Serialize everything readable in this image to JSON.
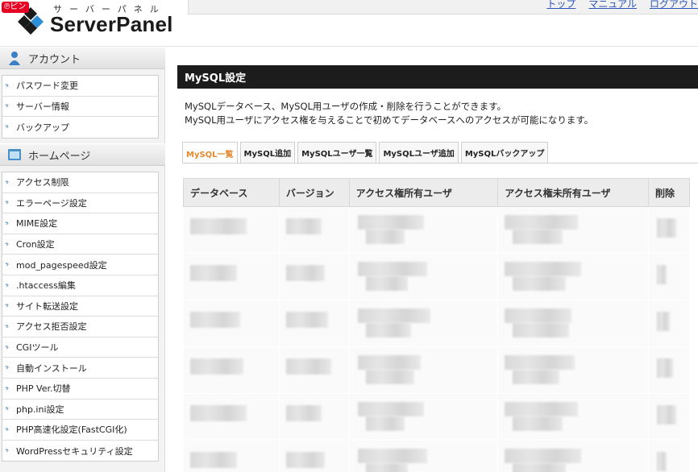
{
  "pin_badge": "ピン",
  "logo": {
    "kana": "サーバーパネル",
    "name": "ServerPanel"
  },
  "top_links": [
    "トップ",
    "マニュアル",
    "ログアウト"
  ],
  "sidebar": {
    "account": {
      "heading": "アカウント",
      "items": [
        "パスワード変更",
        "サーバー情報",
        "バックアップ"
      ]
    },
    "homepage": {
      "heading": "ホームページ",
      "items": [
        "アクセス制限",
        "エラーページ設定",
        "MIME設定",
        "Cron設定",
        "mod_pagespeed設定",
        ".htaccess編集",
        "サイト転送設定",
        "アクセス拒否設定",
        "CGIツール",
        "自動インストール",
        "PHP Ver.切替",
        "php.ini設定",
        "PHP高速化設定(FastCGI化)",
        "WordPressセキュリティ設定"
      ]
    }
  },
  "main": {
    "title": "MySQL設定",
    "desc_line1": "MySQLデータベース、MySQL用ユーザの作成・削除を行うことができます。",
    "desc_line2": "MySQL用ユーザにアクセス権を与えることで初めてデータベースへのアクセスが可能になります。",
    "tabs": [
      "MySQL一覧",
      "MySQL追加",
      "MySQLユーザ一覧",
      "MySQLユーザ追加",
      "MySQLバックアップ"
    ],
    "table_headers": [
      "データベース",
      "バージョン",
      "アクセス権所有ユーザ",
      "アクセス権未所有ユーザ",
      "削除"
    ]
  },
  "colors": {
    "accent_tab": "#e6892e",
    "title_bar": "#1c1c1c",
    "link": "#2c55b5"
  }
}
